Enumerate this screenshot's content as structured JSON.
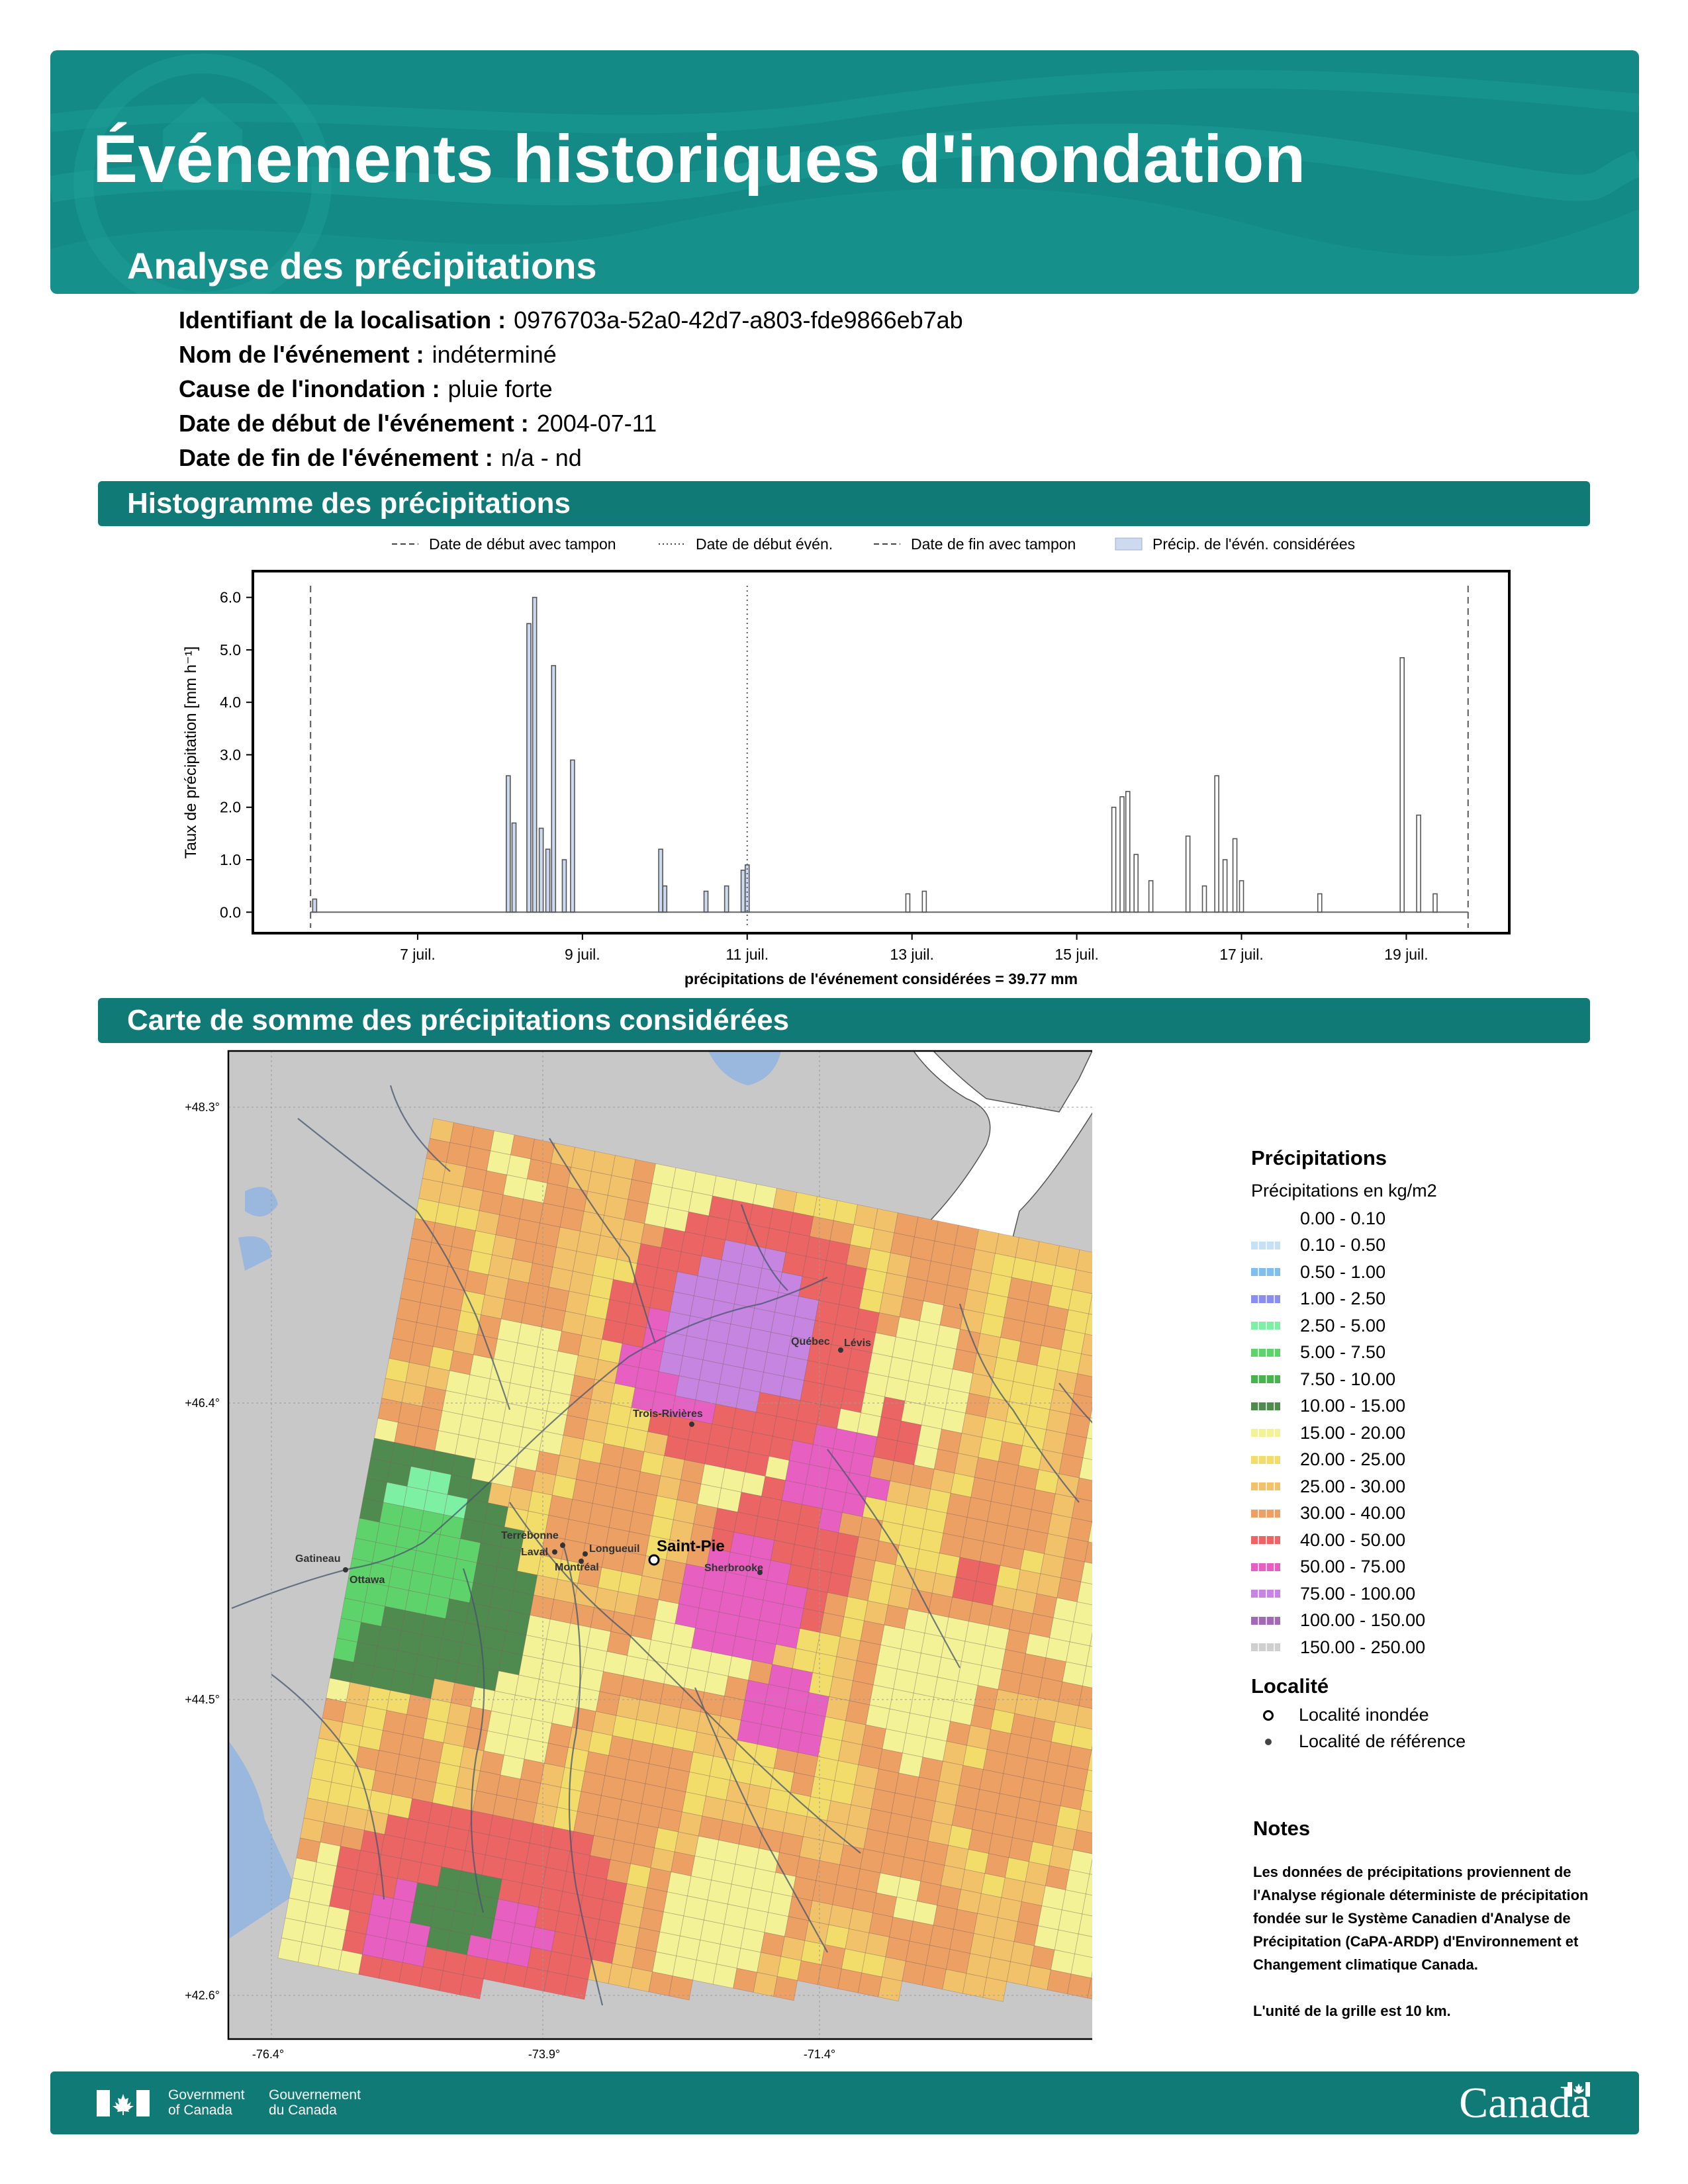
{
  "header": {
    "title": "Événements historiques d'inondation",
    "subtitle": "Analyse des précipitations"
  },
  "meta": [
    {
      "label": "Identifiant de la localisation :",
      "value": "0976703a-52a0-42d7-a803-fde9866eb7ab"
    },
    {
      "label": "Nom de l'événement :",
      "value": "indéterminé"
    },
    {
      "label": "Cause de l'inondation :",
      "value": "pluie forte"
    },
    {
      "label": "Date de début de l'événement :",
      "value": "2004-07-11"
    },
    {
      "label": "Date de fin de l'événement :",
      "value": "n/a - nd"
    }
  ],
  "sections": {
    "histogram": "Histogramme des précipitations",
    "map": "Carte de somme des précipitations considérées"
  },
  "chart_data": {
    "type": "bar",
    "ylabel": "Taux de précipitation [mm h⁻¹]",
    "xlabel": "précipitations de l'événement considérées = 39.77 mm",
    "ylim": [
      -0.4,
      6.5
    ],
    "xlim_days": [
      5,
      20.25
    ],
    "yticks": [
      "0.0",
      "1.0",
      "2.0",
      "3.0",
      "4.0",
      "5.0",
      "6.0"
    ],
    "xticks": [
      {
        "day": 7,
        "label": "7 juil."
      },
      {
        "day": 9,
        "label": "9 juil."
      },
      {
        "day": 11,
        "label": "11 juil."
      },
      {
        "day": 13,
        "label": "13 juil."
      },
      {
        "day": 15,
        "label": "15 juil."
      },
      {
        "day": 17,
        "label": "17 juil."
      },
      {
        "day": 19,
        "label": "19 juil."
      }
    ],
    "legend": [
      {
        "label": "Date de début avec tampon",
        "style": "dashed"
      },
      {
        "label": "Date de début évén.",
        "style": "dotted"
      },
      {
        "label": "Date de fin avec tampon",
        "style": "dashed"
      },
      {
        "label": "Précip. de l'évén. considérées",
        "style": "fill"
      }
    ],
    "vlines": [
      {
        "day": 5.7,
        "style": "dashed"
      },
      {
        "day": 11.0,
        "style": "dotted"
      },
      {
        "day": 19.75,
        "style": "dashed"
      }
    ],
    "shaded_until_day": 11.0,
    "points": [
      [
        5.75,
        0.25
      ],
      [
        8.1,
        2.6
      ],
      [
        8.17,
        1.7
      ],
      [
        8.35,
        5.5
      ],
      [
        8.42,
        6.0
      ],
      [
        8.5,
        1.6
      ],
      [
        8.58,
        1.2
      ],
      [
        8.65,
        4.7
      ],
      [
        8.78,
        1.0
      ],
      [
        8.88,
        2.9
      ],
      [
        9.95,
        1.2
      ],
      [
        10.0,
        0.5
      ],
      [
        10.5,
        0.4
      ],
      [
        10.75,
        0.5
      ],
      [
        10.95,
        0.8
      ],
      [
        11.0,
        0.9
      ],
      [
        12.95,
        0.35
      ],
      [
        13.15,
        0.4
      ],
      [
        15.45,
        2.0
      ],
      [
        15.55,
        2.2
      ],
      [
        15.62,
        2.3
      ],
      [
        15.72,
        1.1
      ],
      [
        15.9,
        0.6
      ],
      [
        16.35,
        1.45
      ],
      [
        16.55,
        0.5
      ],
      [
        16.7,
        2.6
      ],
      [
        16.8,
        1.0
      ],
      [
        16.92,
        1.4
      ],
      [
        17.0,
        0.6
      ],
      [
        17.95,
        0.35
      ],
      [
        18.95,
        4.85
      ],
      [
        19.15,
        1.85
      ],
      [
        19.35,
        0.35
      ]
    ]
  },
  "map": {
    "lat_labels": [
      "+48.3°",
      "+46.4°",
      "+44.5°",
      "+42.6°"
    ],
    "lon_labels": [
      "-76.4°",
      "-73.9°",
      "-71.4°"
    ],
    "cities": [
      {
        "name": "Québec"
      },
      {
        "name": "Lévis"
      },
      {
        "name": "Trois-Rivières"
      },
      {
        "name": "Terrebonne"
      },
      {
        "name": "Laval"
      },
      {
        "name": "Longueuil"
      },
      {
        "name": "Montréal"
      },
      {
        "name": "Gatineau"
      },
      {
        "name": "Ottawa"
      },
      {
        "name": "Sherbrooke"
      }
    ],
    "flooded_locality": "Saint-Pie"
  },
  "legend": {
    "title": "Précipitations",
    "subtitle": "Précipitations en kg/m2",
    "classes": [
      {
        "label": "0.00 - 0.10",
        "color": "#ffffff"
      },
      {
        "label": "0.10 - 0.50",
        "color": "#c6e1f5"
      },
      {
        "label": "0.50 - 1.00",
        "color": "#7fbff0"
      },
      {
        "label": "1.00 - 2.50",
        "color": "#8a8ef0"
      },
      {
        "label": "2.50 - 5.00",
        "color": "#7ef0a4"
      },
      {
        "label": "5.00 - 7.50",
        "color": "#5fd36b"
      },
      {
        "label": "7.50 - 10.00",
        "color": "#49b352"
      },
      {
        "label": "10.00 - 15.00",
        "color": "#4f8a4f"
      },
      {
        "label": "15.00 - 20.00",
        "color": "#f4f296"
      },
      {
        "label": "20.00 - 25.00",
        "color": "#f2dc6a"
      },
      {
        "label": "25.00 - 30.00",
        "color": "#f1c26a"
      },
      {
        "label": "30.00 - 40.00",
        "color": "#eda063"
      },
      {
        "label": "40.00 - 50.00",
        "color": "#eb6565"
      },
      {
        "label": "50.00 - 75.00",
        "color": "#e85fc2"
      },
      {
        "label": "75.00 - 100.00",
        "color": "#c585e0"
      },
      {
        "label": "100.00 - 150.00",
        "color": "#a06ab5"
      },
      {
        "label": "150.00 - 250.00",
        "color": "#cfcfcf"
      }
    ],
    "locality_title": "Localité",
    "localities": [
      {
        "label": "Localité inondée"
      },
      {
        "label": "Localité de référence"
      }
    ]
  },
  "notes": {
    "title": "Notes",
    "body": "Les données de précipitations proviennent de l'Analyse régionale déterministe de précipitation fondée sur le Système Canadien d'Analyse de Précipitation (CaPA-ARDP) d'Environnement et Changement climatique Canada.",
    "unit": "L'unité de la grille est 10 km."
  },
  "footer": {
    "gov_en_1": "Government",
    "gov_en_2": "of Canada",
    "gov_fr_1": "Gouvernement",
    "gov_fr_2": "du Canada",
    "wordmark": "Canada"
  },
  "colors": {
    "teal": "#138a85",
    "teal_dark": "#0f7a76",
    "land": "#c8c8c8",
    "water": "#9ab7de"
  }
}
